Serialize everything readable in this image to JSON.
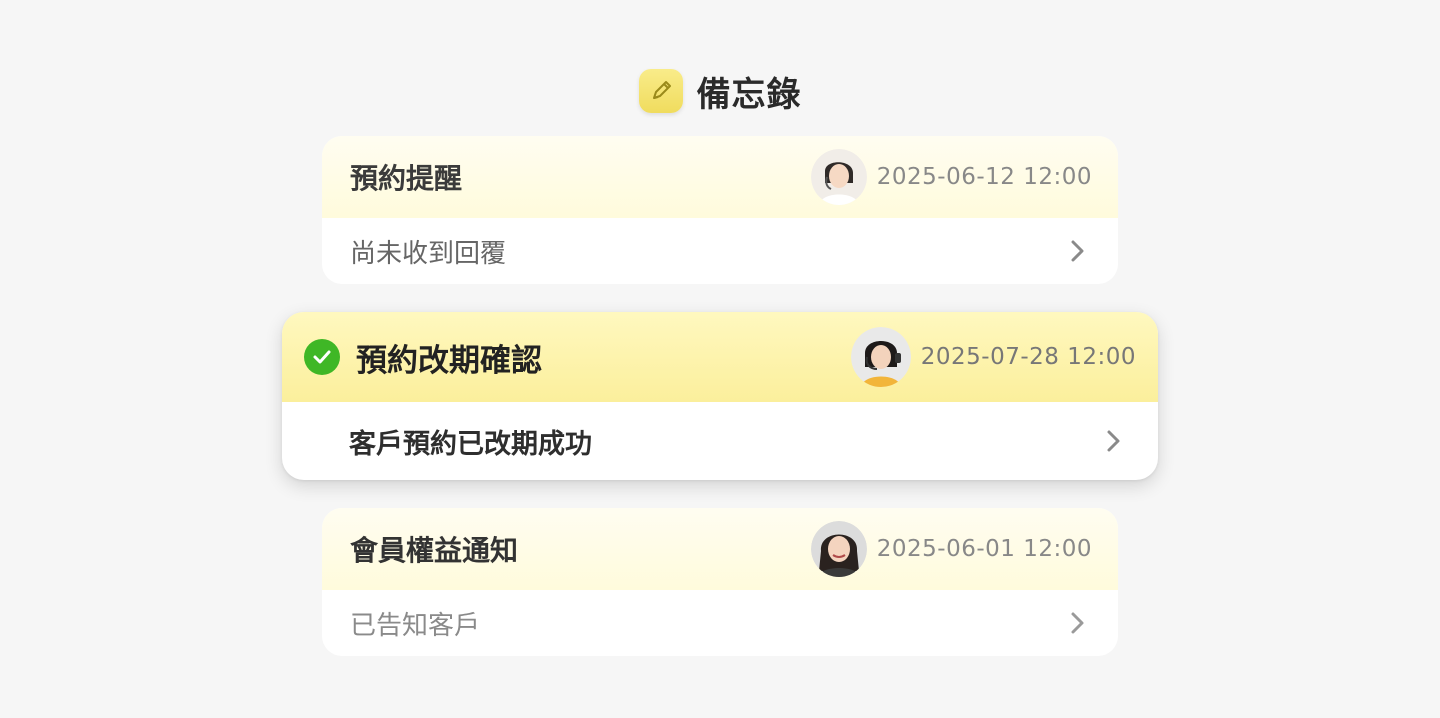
{
  "header": {
    "title": "備忘錄",
    "icon": "pencil-icon"
  },
  "colors": {
    "accent": "#f0dc5e",
    "check": "#3fb726",
    "highlight": "#fbef9c"
  },
  "memos": [
    {
      "title": "預約提醒",
      "time": "2025-06-12 12:00",
      "subtitle": "尚未收到回覆",
      "avatar": "customer-service-avatar"
    },
    {
      "title": "預約改期確認",
      "time": "2025-07-28 12:00",
      "subtitle": "客戶預約已改期成功",
      "avatar": "customer-service-avatar",
      "checked": true
    },
    {
      "title": "會員權益通知",
      "time": "2025-06-01 12:00",
      "subtitle": "已告知客戶",
      "avatar": "customer-service-avatar"
    }
  ]
}
